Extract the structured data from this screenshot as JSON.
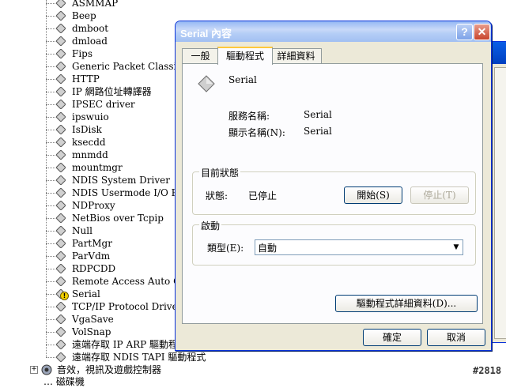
{
  "tree": {
    "items": [
      "ASMMAP",
      "Beep",
      "dmboot",
      "dmload",
      "Fips",
      "Generic Packet Classifier",
      "HTTP",
      "IP 網路位址轉譯器",
      "IPSEC driver",
      "ipswuio",
      "IsDisk",
      "ksecdd",
      "mnmdd",
      "mountmgr",
      "NDIS System Driver",
      "NDIS Usermode I/O Protoc",
      "NDProxy",
      "NetBios over Tcpip",
      "Null",
      "PartMgr",
      "ParVdm",
      "RDPCDD",
      "Remote Access Auto Conne",
      "Serial",
      "TCP/IP Protocol Driver",
      "VgaSave",
      "VolSnap",
      "遠端存取 IP ARP 驅動程式",
      "遠端存取 NDIS TAPI 驅動程式"
    ],
    "warning_item": "Serial",
    "category": {
      "expander": "+",
      "label": "音效，視訊及遊戲控制器"
    },
    "partial_label": "… 磁碟機"
  },
  "dialog": {
    "title": "Serial 內容",
    "help_label": "?",
    "close_label": "✕",
    "tabs": [
      "一般",
      "驅動程式",
      "詳細資料"
    ],
    "active_tab": "驅動程式",
    "driver_name": "Serial",
    "service_name_label": "服務名稱:",
    "service_name_value": "Serial",
    "display_name_label": "顯示名稱(N):",
    "display_name_value": "Serial",
    "status_group_title": "目前狀態",
    "status_label": "狀態:",
    "status_value": "已停止",
    "start_button": "開始(S)",
    "stop_button": "停止(T)",
    "startup_group_title": "啟動",
    "type_label": "類型(E):",
    "type_value": "自動",
    "dropdown_arrow": "▼",
    "details_button": "驅動程式詳細資料(D)...",
    "ok_button": "確定",
    "cancel_button": "取消"
  },
  "watermark": "#2818",
  "colors": {
    "title_gradient": "#a2c0f2",
    "dialog_bg": "#ece9d8",
    "tab_highlight": "#ffc83c",
    "warning": "#f2d000"
  }
}
